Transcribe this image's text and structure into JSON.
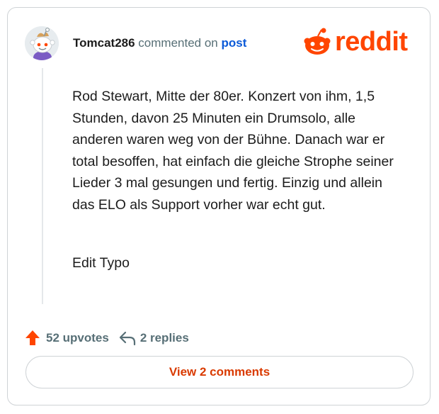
{
  "header": {
    "username": "Tomcat286",
    "action": "commented on",
    "post_link": "post"
  },
  "logo": {
    "wordmark": "reddit",
    "icon": "reddit-snoo-icon",
    "color": "#ff4500"
  },
  "comment": {
    "body": "Rod Stewart, Mitte der 80er. Konzert von ihm, 1,5 Stunden, davon 25 Minuten ein Drumsolo, alle anderen waren weg von der Bühne. Danach war er total besoffen, hat einfach die gleiche Strophe seiner Lieder 3 mal gesungen und fertig. Einzig und allein das ELO als Support vorher war echt gut.",
    "edit_note": "Edit Typo"
  },
  "stats": {
    "upvotes": "52 upvotes",
    "replies": "2 replies",
    "upvote_icon": "upvote-arrow-icon",
    "reply_icon": "reply-arrow-icon"
  },
  "view_button": {
    "label": "View 2 comments"
  },
  "colors": {
    "accent": "#ff4500",
    "link": "#0b5ad8",
    "muted": "#576f76",
    "button_text": "#d93a00"
  }
}
